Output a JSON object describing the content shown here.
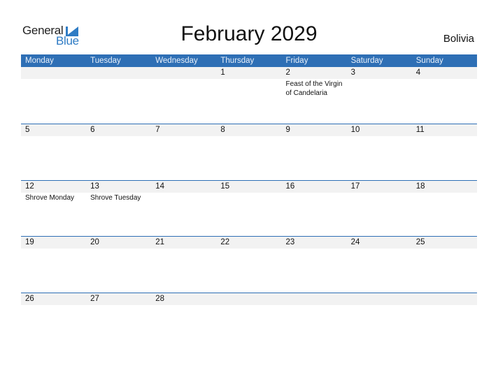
{
  "logo": {
    "line1": "General",
    "line2": "Blue",
    "accent_color": "#2E7BC4"
  },
  "header": {
    "title": "February 2029",
    "country": "Bolivia"
  },
  "colors": {
    "header_bar": "#2E6FB5",
    "date_strip": "#F2F2F2",
    "row_border": "#2E6FB5"
  },
  "weekdays": [
    "Monday",
    "Tuesday",
    "Wednesday",
    "Thursday",
    "Friday",
    "Saturday",
    "Sunday"
  ],
  "weeks": [
    {
      "days": [
        {
          "date": "",
          "event": ""
        },
        {
          "date": "",
          "event": ""
        },
        {
          "date": "",
          "event": ""
        },
        {
          "date": "1",
          "event": ""
        },
        {
          "date": "2",
          "event": "Feast of the Virgin of Candelaria"
        },
        {
          "date": "3",
          "event": ""
        },
        {
          "date": "4",
          "event": ""
        }
      ]
    },
    {
      "days": [
        {
          "date": "5",
          "event": ""
        },
        {
          "date": "6",
          "event": ""
        },
        {
          "date": "7",
          "event": ""
        },
        {
          "date": "8",
          "event": ""
        },
        {
          "date": "9",
          "event": ""
        },
        {
          "date": "10",
          "event": ""
        },
        {
          "date": "11",
          "event": ""
        }
      ]
    },
    {
      "days": [
        {
          "date": "12",
          "event": "Shrove Monday"
        },
        {
          "date": "13",
          "event": "Shrove Tuesday"
        },
        {
          "date": "14",
          "event": ""
        },
        {
          "date": "15",
          "event": ""
        },
        {
          "date": "16",
          "event": ""
        },
        {
          "date": "17",
          "event": ""
        },
        {
          "date": "18",
          "event": ""
        }
      ]
    },
    {
      "days": [
        {
          "date": "19",
          "event": ""
        },
        {
          "date": "20",
          "event": ""
        },
        {
          "date": "21",
          "event": ""
        },
        {
          "date": "22",
          "event": ""
        },
        {
          "date": "23",
          "event": ""
        },
        {
          "date": "24",
          "event": ""
        },
        {
          "date": "25",
          "event": ""
        }
      ]
    },
    {
      "days": [
        {
          "date": "26",
          "event": ""
        },
        {
          "date": "27",
          "event": ""
        },
        {
          "date": "28",
          "event": ""
        },
        {
          "date": "",
          "event": ""
        },
        {
          "date": "",
          "event": ""
        },
        {
          "date": "",
          "event": ""
        },
        {
          "date": "",
          "event": ""
        }
      ]
    }
  ]
}
